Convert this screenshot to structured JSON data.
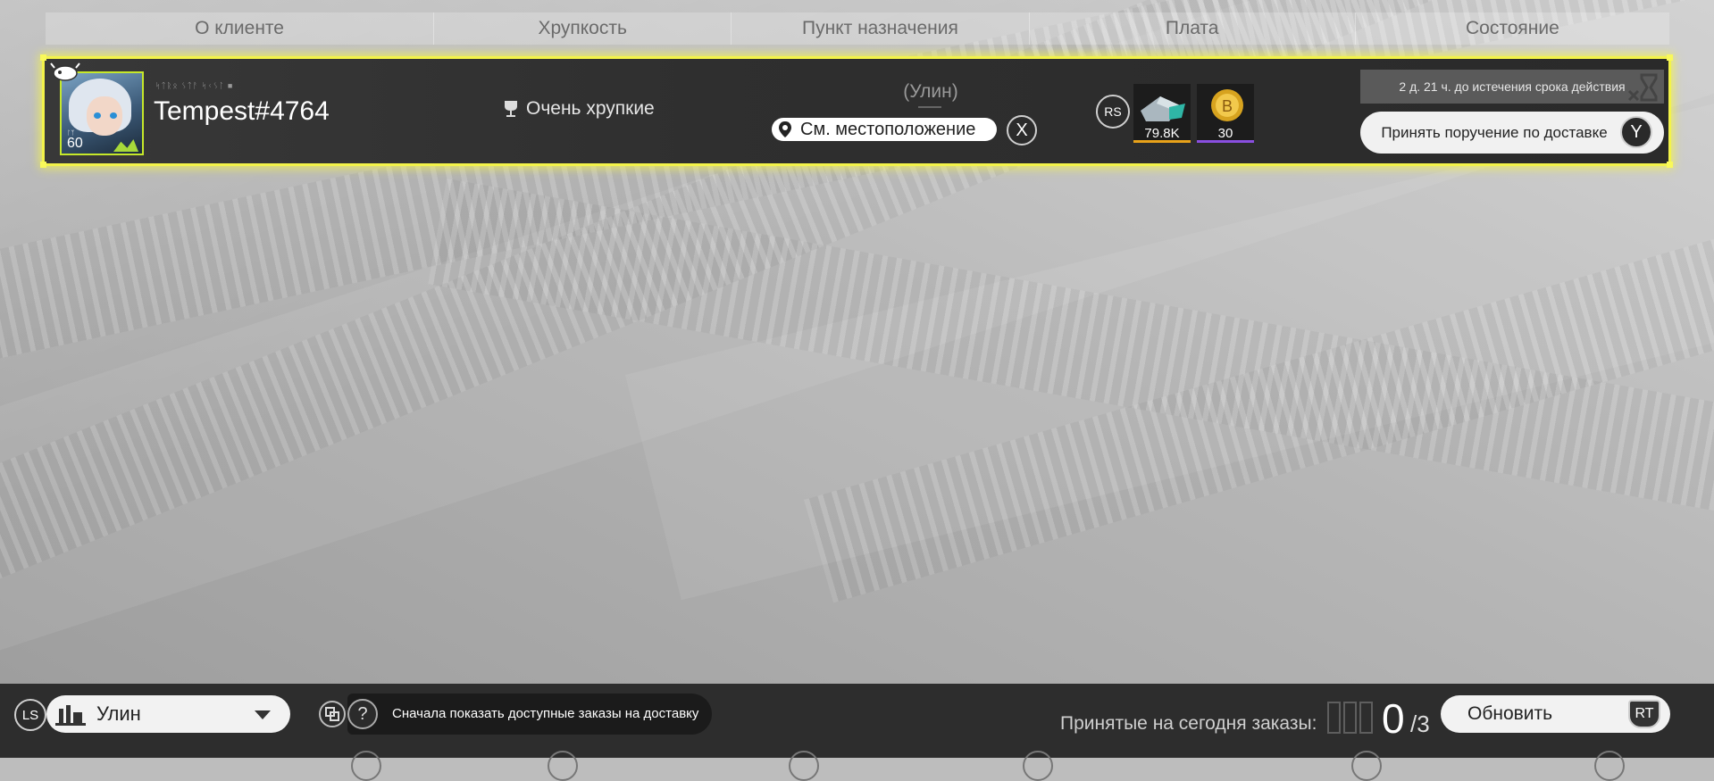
{
  "header": {
    "columns": [
      "О клиенте",
      "Хрупкость",
      "Пункт назначения",
      "Плата",
      "Состояние"
    ]
  },
  "order": {
    "client_subtitle": "ᛋᛏᚱᛟ ᛊᛏᚨ ᛋᚲᛊᛚ ■",
    "client_name": "Tempest#4764",
    "client_level_tag": "ᛚᛉ",
    "client_level": "60",
    "fragility": "Очень хрупкие",
    "destination": "(Улин)",
    "location_button": "См. местоположение",
    "location_key": "X",
    "rewards_key": "RS",
    "rewards": [
      {
        "icon": "materials-icon",
        "amount": "79.8K",
        "bar_color": "#e8a21a"
      },
      {
        "icon": "gold-coin-icon",
        "amount": "30",
        "bar_color": "#8a4fe0"
      }
    ],
    "status_text": "2 д. 21 ч. до истечения срока действия",
    "accept_button": "Принять поручение по доставке",
    "accept_key": "Y",
    "highlight_color": "#f3f34a"
  },
  "bottom": {
    "ls_key": "LS",
    "region": "Улин",
    "help_key": "?",
    "hint": "Сначала показать доступные заказы на доставку",
    "accepted_label": "Принятые на сегодня заказы:",
    "accepted_count": "0",
    "accepted_total": "/3",
    "refresh_button": "Обновить",
    "rt_key": "RT"
  }
}
